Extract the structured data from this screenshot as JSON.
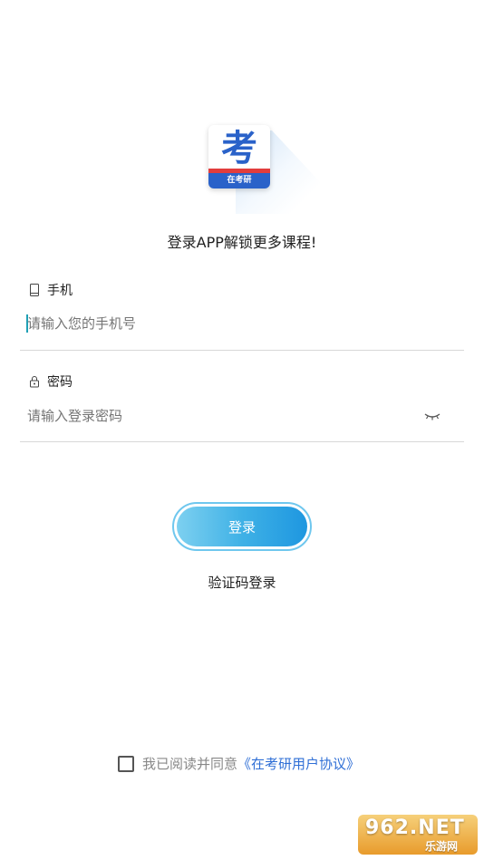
{
  "logo": {
    "glyph": "考",
    "band_text": "在考研"
  },
  "tagline": "登录APP解锁更多课程!",
  "phone": {
    "label": "手机",
    "placeholder": "请输入您的手机号"
  },
  "password": {
    "label": "密码",
    "placeholder": "请输入登录密码"
  },
  "login_button": "登录",
  "sms_login": "验证码登录",
  "agreement": {
    "prefix": "我已阅读并同意",
    "link": "《在考研用户协议》"
  },
  "watermark": {
    "logo": "962.NET",
    "sub": "乐游网"
  },
  "colors": {
    "accent": "#1e97e0",
    "link": "#2f6fd6",
    "cursor": "#1fa0b5"
  }
}
